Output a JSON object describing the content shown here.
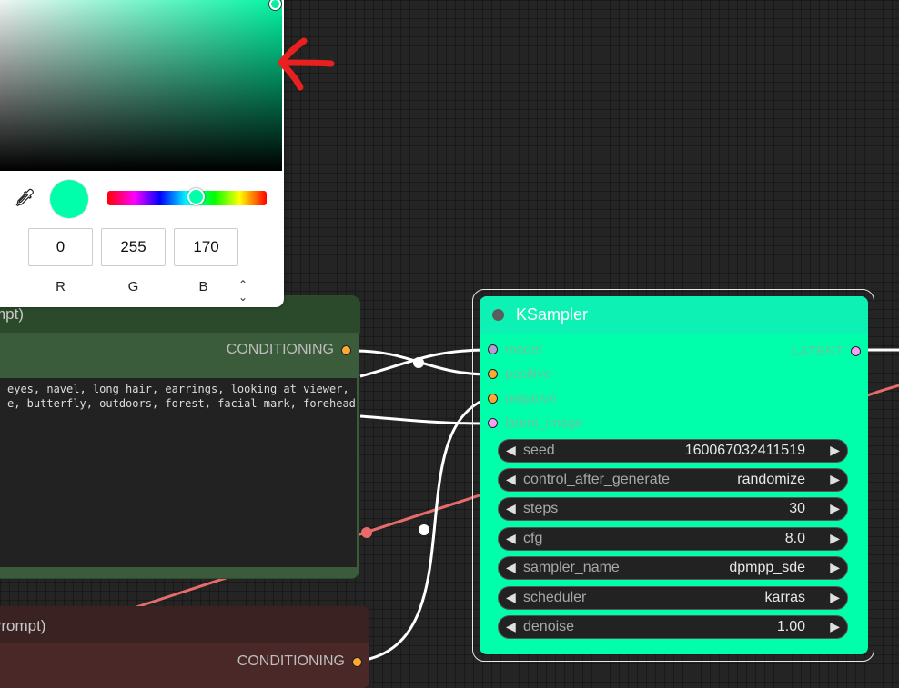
{
  "nodes": {
    "clip_positive": {
      "title": "mpt)",
      "output_label": "CONDITIONING",
      "prompt_text": "eyes, navel, long hair, earrings, looking at viewer,\ne, butterfly, outdoors, forest, facial mark, forehead"
    },
    "clip_negative": {
      "title": "Prompt)",
      "output_label": "CONDITIONING"
    },
    "ksampler": {
      "title": "KSampler",
      "inputs": [
        "model",
        "positive",
        "negative",
        "latent_image"
      ],
      "output_label": "LATENT",
      "widgets": [
        {
          "name": "seed",
          "value": "160067032411519"
        },
        {
          "name": "control_after_generate",
          "value": "randomize"
        },
        {
          "name": "steps",
          "value": "30"
        },
        {
          "name": "cfg",
          "value": "8.0"
        },
        {
          "name": "sampler_name",
          "value": "dpmpp_sde"
        },
        {
          "name": "scheduler",
          "value": "karras"
        },
        {
          "name": "denoise",
          "value": "1.00"
        }
      ]
    }
  },
  "color_picker": {
    "r": "0",
    "g": "255",
    "b": "170",
    "label_r": "R",
    "label_g": "G",
    "label_b": "B",
    "mode_toggle_icon": "chevron-updown-icon",
    "dropper_icon": "eyedropper-icon",
    "current_color": "#00ffaa"
  },
  "colors": {
    "ksampler_bg": "#00ffaa",
    "clip_positive_bg": "#355a35",
    "clip_negative_bg": "#4a2828",
    "conditioning_dot": "#ffa931",
    "latent_dot": "#ff9cf9",
    "model_dot": "#b39ddb",
    "clip_link": "#ff6b6b",
    "annotation_arrow": "#e8201f"
  }
}
